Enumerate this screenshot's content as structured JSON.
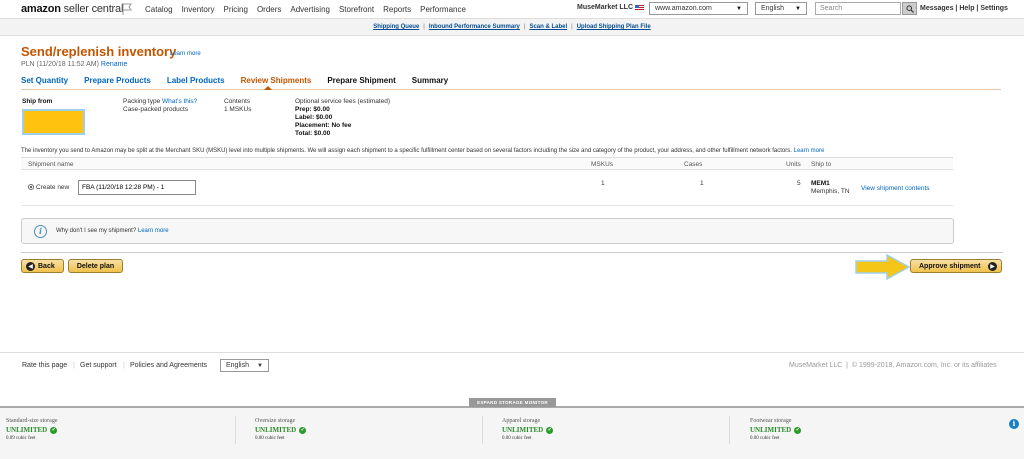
{
  "header": {
    "logo_brand": "amazon",
    "logo_product": "seller central",
    "nav": [
      "Catalog",
      "Inventory",
      "Pricing",
      "Orders",
      "Advertising",
      "Storefront",
      "Reports",
      "Performance"
    ],
    "merchant": "MuseMarket LLC",
    "marketplace": "www.amazon.com",
    "language": "English",
    "search_placeholder": "Search",
    "links": "Messages | Help | Settings"
  },
  "subnav": [
    "Shipping Queue",
    "Inbound Performance Summary",
    "Scan & Label",
    "Upload Shipping Plan File"
  ],
  "page": {
    "title": "Send/replenish inventory",
    "learn_more": "Learn more",
    "plan_name": "PLN (11/20/18 11:52 AM)",
    "rename": "Rename"
  },
  "steps": {
    "done": [
      "Set Quantity",
      "Prepare Products",
      "Label Products"
    ],
    "active": "Review Shipments",
    "todo": [
      "Prepare Shipment",
      "Summary"
    ]
  },
  "shipment_info": {
    "ship_from_label": "Ship from",
    "packing_type_label": "Packing type",
    "whats_this": "What's this?",
    "packing_type_value": "Case-packed products",
    "contents_label": "Contents",
    "contents_value": "1 MSKUs",
    "fees_label": "Optional service fees (estimated)",
    "prep": "Prep: $0.00",
    "label": "Label: $0.00",
    "placement": "Placement: No fee",
    "total": "Total: $0.00"
  },
  "note": "The inventory you send to Amazon may be split at the Merchant SKU (MSKU) level into multiple shipments. We will assign each shipment to a specific fulfillment center based on several factors including the size and category of the product, your address, and other fulfillment network factors.",
  "note_link": "Learn more",
  "table": {
    "headers": [
      "Shipment name",
      "MSKUs",
      "Cases",
      "Units",
      "Ship to"
    ],
    "row": {
      "option": "Create new",
      "name": "FBA (11/20/18 12:28 PM) - 1",
      "mskus": "1",
      "cases": "1",
      "units": "5",
      "fc_code": "MEM1",
      "fc_city": "Memphis, TN",
      "view_link": "View shipment contents"
    }
  },
  "info": {
    "text": "Why don't I see my shipment?",
    "link": "Learn more"
  },
  "actions": {
    "back": "Back",
    "delete": "Delete plan",
    "approve": "Approve shipment"
  },
  "footer": {
    "rate": "Rate this page",
    "support": "Get support",
    "policies": "Policies and Agreements",
    "language": "English",
    "merchant": "MuseMarket LLC",
    "copyright": "© 1999-2018, Amazon.com, Inc. or its affiliates"
  },
  "storage": {
    "expand": "EXPAND STORAGE MONITOR",
    "items": [
      {
        "type": "Standard-size storage",
        "status": "UNLIMITED",
        "usage": "0.09 cubic feet"
      },
      {
        "type": "Oversize storage",
        "status": "UNLIMITED",
        "usage": "0.00 cubic feet"
      },
      {
        "type": "Apparel storage",
        "status": "UNLIMITED",
        "usage": "0.00 cubic feet"
      },
      {
        "type": "Footwear storage",
        "status": "UNLIMITED",
        "usage": "0.00 cubic feet"
      }
    ]
  },
  "colors": {
    "accent": "#c45500",
    "link": "#0066c0",
    "highlight": "#ffc30f",
    "arrow": "#f5c518",
    "ok": "#2a8a2a"
  }
}
